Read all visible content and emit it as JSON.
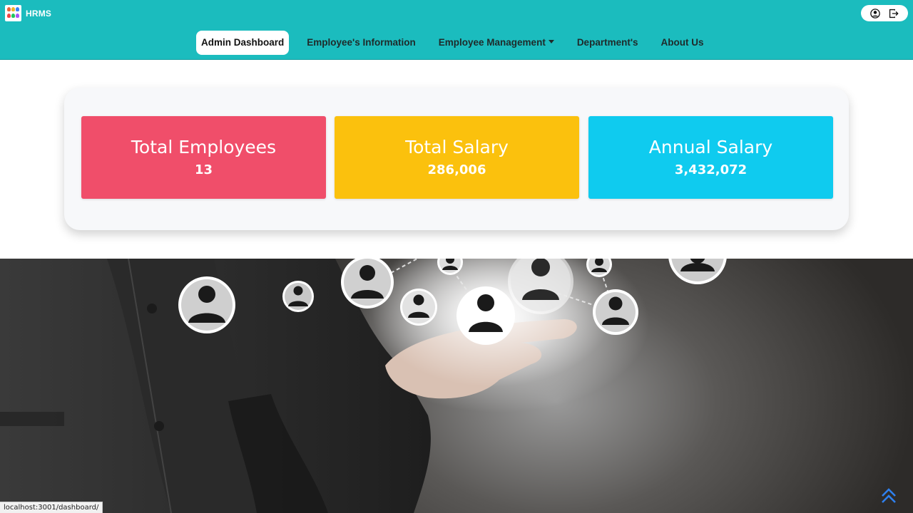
{
  "header": {
    "brand_name": "HRMS",
    "logo_colors": [
      "#e8643c",
      "#f0b429",
      "#3b82f6",
      "#ef4444",
      "#22c55e",
      "#a855f7"
    ]
  },
  "nav": {
    "items": [
      {
        "label": "Admin Dashboard",
        "active": true
      },
      {
        "label": "Employee's Information",
        "active": false
      },
      {
        "label": "Employee Management",
        "active": false,
        "dropdown": true
      },
      {
        "label": "Department's",
        "active": false
      },
      {
        "label": "About Us",
        "active": false
      }
    ]
  },
  "user_menu": {
    "icons": [
      "user-circle-icon",
      "logout-icon"
    ]
  },
  "stats": [
    {
      "title": "Total Employees",
      "value": "13",
      "color": "#f04e6a"
    },
    {
      "title": "Total Salary",
      "value": "286,006",
      "color": "#fbc10d"
    },
    {
      "title": "Annual Salary",
      "value": "3,432,072",
      "color": "#0fcbef"
    }
  ],
  "status_bar": {
    "url": "localhost:3001/dashboard/"
  },
  "colors": {
    "header_bg": "#1bbcbe",
    "scroll_top": "#2f80ed"
  }
}
